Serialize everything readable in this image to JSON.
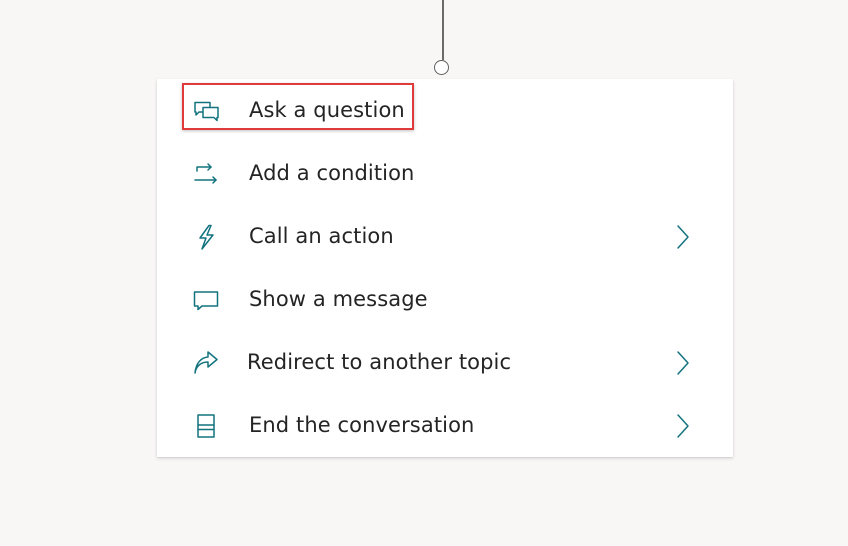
{
  "accent_color": "#12737f",
  "highlight_color": "#e03b3b",
  "menu": {
    "items": [
      {
        "label": "Ask a question",
        "icon": "chat-bubbles-icon",
        "has_submenu": false,
        "highlighted": true
      },
      {
        "label": "Add a condition",
        "icon": "branch-arrows-icon",
        "has_submenu": false,
        "highlighted": false
      },
      {
        "label": "Call an action",
        "icon": "lightning-bolt-icon",
        "has_submenu": true,
        "highlighted": false
      },
      {
        "label": "Show a message",
        "icon": "speech-bubble-icon",
        "has_submenu": false,
        "highlighted": false
      },
      {
        "label": "Redirect to another topic",
        "icon": "share-arrow-icon",
        "has_submenu": true,
        "highlighted": false
      },
      {
        "label": "End the conversation",
        "icon": "end-document-icon",
        "has_submenu": true,
        "highlighted": false
      }
    ]
  }
}
